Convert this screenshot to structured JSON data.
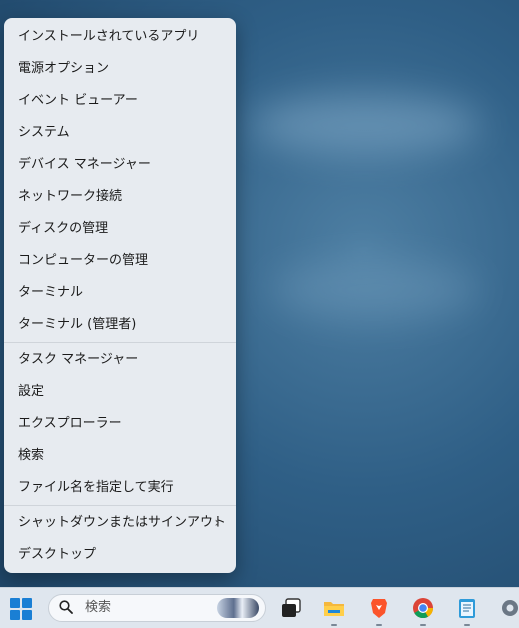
{
  "context_menu": {
    "items": [
      {
        "label": "インストールされているアプリ"
      },
      {
        "label": "電源オプション"
      },
      {
        "label": "イベント ビューアー"
      },
      {
        "label": "システム"
      },
      {
        "label": "デバイス マネージャー"
      },
      {
        "label": "ネットワーク接続"
      },
      {
        "label": "ディスクの管理"
      },
      {
        "label": "コンピューターの管理"
      },
      {
        "label": "ターミナル"
      },
      {
        "label": "ターミナル (管理者)"
      },
      {
        "label": "タスク マネージャー"
      },
      {
        "label": "設定"
      },
      {
        "label": "エクスプローラー"
      },
      {
        "label": "検索"
      },
      {
        "label": "ファイル名を指定して実行"
      },
      {
        "label": "シャットダウンまたはサインアウト",
        "submenu_indicator": "›"
      },
      {
        "label": "デスクトップ"
      }
    ]
  },
  "taskbar": {
    "start_icon": "windows-start-icon",
    "search": {
      "placeholder": "検索"
    },
    "apps": [
      {
        "icon": "task-view-icon"
      },
      {
        "icon": "file-explorer-icon"
      },
      {
        "icon": "brave-browser-icon"
      },
      {
        "icon": "chrome-browser-icon"
      },
      {
        "icon": "notepad-icon"
      },
      {
        "icon": "settings-gear-icon"
      }
    ]
  },
  "colors": {
    "menu_background": "#e7ebf0",
    "taskbar_background": "#dfe6ee",
    "start_blue": "#1a7fd4",
    "wallpaper": "#2f5f86"
  }
}
